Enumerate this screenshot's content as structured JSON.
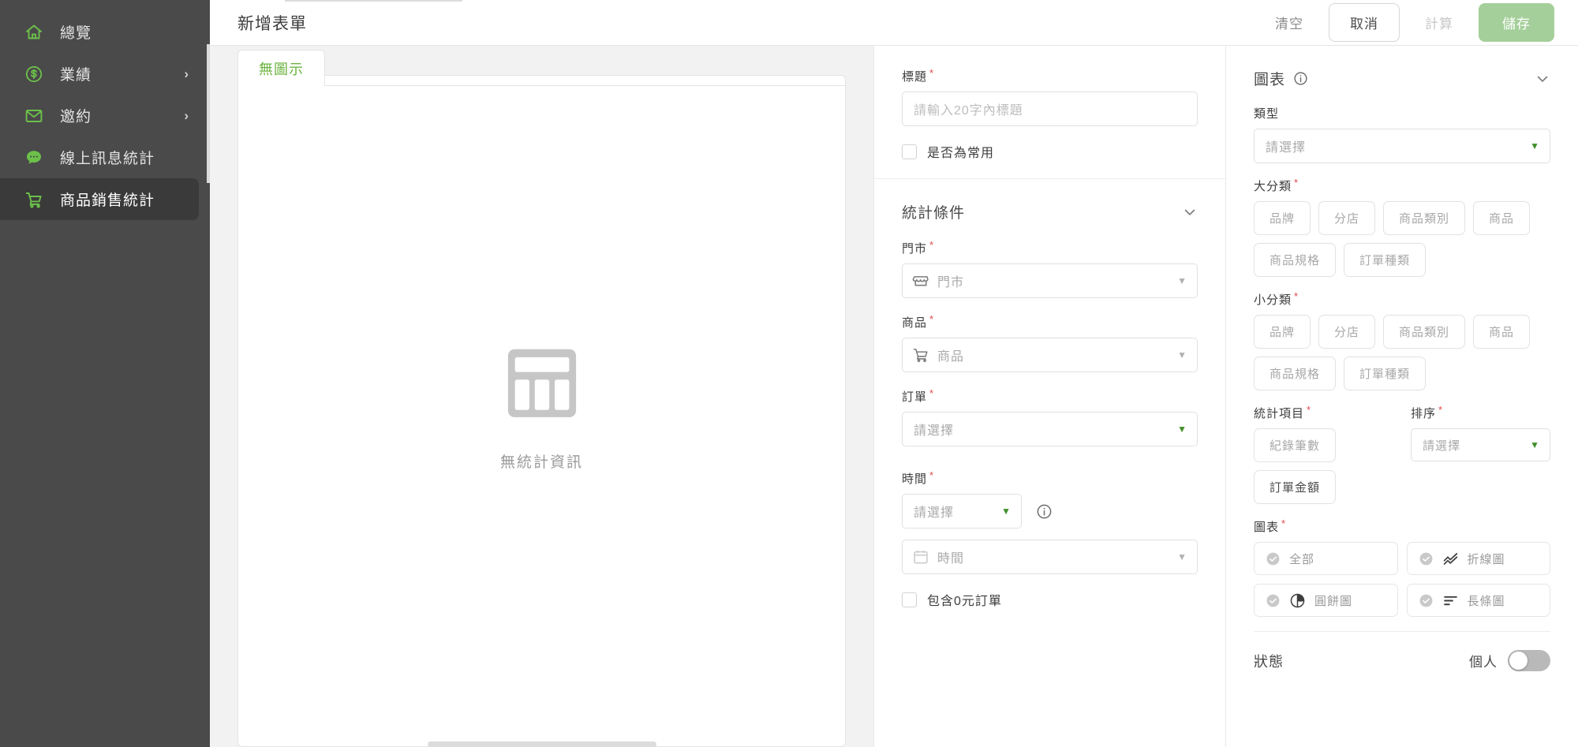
{
  "sidebar": {
    "items": [
      {
        "label": "總覽",
        "icon": "home-icon",
        "chevron": "",
        "active": false
      },
      {
        "label": "業績",
        "icon": "dollar-circle-icon",
        "chevron": "›",
        "active": false
      },
      {
        "label": "邀約",
        "icon": "mail-icon",
        "chevron": "›",
        "active": false
      },
      {
        "label": "線上訊息統計",
        "icon": "chat-bubble-icon",
        "chevron": "",
        "active": false
      },
      {
        "label": "商品銷售統計",
        "icon": "shopping-cart-icon",
        "chevron": "",
        "active": true
      }
    ],
    "accent_color": "#6cc04a",
    "bg_color": "#4a4a4a"
  },
  "topbar": {
    "title": "新增表單",
    "clear_label": "清空",
    "cancel_label": "取消",
    "calculate_label": "計算",
    "save_label": "儲存",
    "primary_color": "#a5cf9a"
  },
  "preview": {
    "tab_label": "無圖示",
    "tab_color": "#6cb33f",
    "empty_icon": "table-grid-icon",
    "empty_text": "無統計資訊"
  },
  "form": {
    "title_field": {
      "label": "標題",
      "required": true,
      "value": "",
      "placeholder": "請輸入20字內標題"
    },
    "favorite_checkbox": {
      "label": "是否為常用",
      "checked": false
    },
    "conditions": {
      "header": "統計條件",
      "chevron": "chevron-down-icon",
      "fields": [
        {
          "label": "門市",
          "required": true,
          "icon": "store-icon",
          "value": "門市",
          "caret": "gray"
        },
        {
          "label": "商品",
          "required": true,
          "icon": "shopping-cart-icon",
          "value": "商品",
          "caret": "gray"
        },
        {
          "label": "訂單",
          "required": true,
          "icon": "",
          "value": "請選擇",
          "caret": "green"
        }
      ],
      "time": {
        "label": "時間",
        "required": true,
        "range_value": "請選擇",
        "range_caret": "green",
        "info_icon": "info-icon",
        "date_icon": "calendar-icon",
        "date_value": "時間",
        "date_caret": "gray"
      },
      "zero_order_checkbox": {
        "label": "包含0元訂單",
        "checked": false
      }
    }
  },
  "chart_config": {
    "header": "圖表",
    "header_info_icon": "info-icon",
    "chevron": "chevron-down-icon",
    "type": {
      "label": "類型",
      "required": false,
      "value": "請選擇",
      "caret": "green"
    },
    "major_category": {
      "label": "大分類",
      "required": true,
      "options": [
        "品牌",
        "分店",
        "商品類別",
        "商品",
        "商品規格",
        "訂單種類"
      ]
    },
    "minor_category": {
      "label": "小分類",
      "required": true,
      "options": [
        "品牌",
        "分店",
        "商品類別",
        "商品",
        "商品規格",
        "訂單種類"
      ]
    },
    "stat_item": {
      "label": "統計項目",
      "required": true,
      "options": [
        "紀錄筆數",
        "訂單金額"
      ]
    },
    "sort": {
      "label": "排序",
      "required": true,
      "value": "請選擇",
      "caret": "green"
    },
    "charts": {
      "label": "圖表",
      "required": true,
      "options": [
        {
          "label": "全部",
          "icon": "",
          "checked": false
        },
        {
          "label": "折線圖",
          "icon": "line-chart-icon",
          "checked": false
        },
        {
          "label": "圓餅圖",
          "icon": "pie-chart-icon",
          "checked": false
        },
        {
          "label": "長條圖",
          "icon": "bar-chart-icon",
          "checked": false
        }
      ]
    },
    "status": {
      "label": "狀態",
      "mode_label": "個人",
      "toggle_on": false
    }
  }
}
